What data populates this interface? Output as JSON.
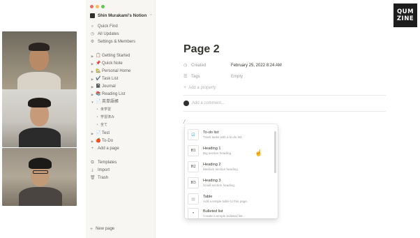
{
  "logo": {
    "line1": "QUM",
    "line2": "ZINE"
  },
  "workspace": {
    "name": "Shin Murakami's Notion",
    "chevron": "⌃"
  },
  "traffic_colors": [
    "#ee6a5e",
    "#f5bd4f",
    "#61c454"
  ],
  "nav": [
    {
      "icon": "search-icon",
      "glyph": "⌕",
      "label": "Quick Find"
    },
    {
      "icon": "clock-icon",
      "glyph": "◷",
      "label": "All Updates"
    },
    {
      "icon": "gear-icon",
      "glyph": "⚙",
      "label": "Settings & Members"
    }
  ],
  "tree": [
    {
      "emoji": "📋",
      "label": "Getting Started"
    },
    {
      "emoji": "📌",
      "label": "Quick Note"
    },
    {
      "emoji": "🏡",
      "label": "Personal Home"
    },
    {
      "emoji": "✔️",
      "label": "Task List"
    },
    {
      "emoji": "📓",
      "label": "Journal"
    },
    {
      "emoji": "📚",
      "label": "Reading List"
    },
    {
      "emoji": "📄",
      "label": "英単語帳"
    }
  ],
  "subitems": [
    "未学習",
    "学習済み",
    "全て"
  ],
  "tree2": [
    {
      "emoji": "📄",
      "label": "Test"
    },
    {
      "emoji": "🍎",
      "label": "To-Do"
    }
  ],
  "add_page": {
    "glyph": "+",
    "label": "Add a page"
  },
  "bottom_nav": [
    {
      "icon": "templates-icon",
      "glyph": "⧉",
      "label": "Templates"
    },
    {
      "icon": "import-icon",
      "glyph": "⤓",
      "label": "Import"
    },
    {
      "icon": "trash-icon",
      "glyph": "🗑",
      "label": "Trash"
    }
  ],
  "new_page": {
    "glyph": "+",
    "label": "New page"
  },
  "page": {
    "title": "Page 2",
    "properties": [
      {
        "icon": "clock-icon",
        "glyph": "◷",
        "name": "Created",
        "value": "February 25, 2022 8:24 AM"
      },
      {
        "icon": "tag-icon",
        "glyph": "☰",
        "name": "Tags",
        "value": "Empty"
      }
    ],
    "add_property": {
      "glyph": "+",
      "label": "Add a property"
    },
    "comment_placeholder": "Add a comment...",
    "slash": "/"
  },
  "menu": [
    {
      "thumb": "☑",
      "title": "To-do list",
      "desc": "Track tasks with a to-do list."
    },
    {
      "thumb": "H1",
      "title": "Heading 1",
      "desc": "Big section heading."
    },
    {
      "thumb": "H2",
      "title": "Heading 2",
      "desc": "Medium section heading."
    },
    {
      "thumb": "H3",
      "title": "Heading 3",
      "desc": "Small section heading."
    },
    {
      "thumb": "▦",
      "title": "Table",
      "desc": "Add a simple table to this page."
    },
    {
      "thumb": "•",
      "title": "Bulleted list",
      "desc": "Create a simple bulleted list."
    }
  ]
}
